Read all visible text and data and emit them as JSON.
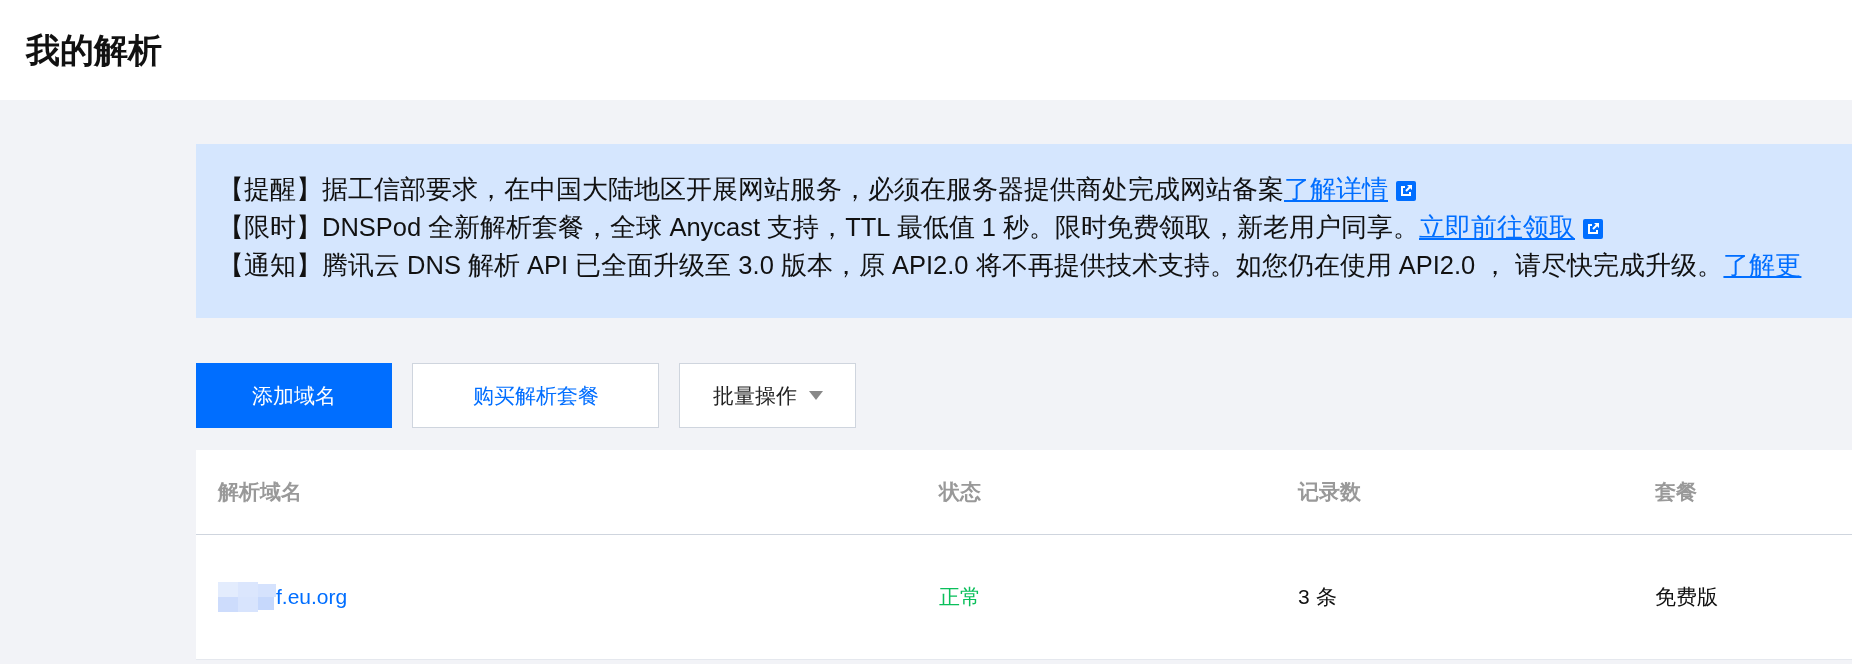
{
  "page_title": "我的解析",
  "notices": [
    {
      "text": "【提醒】据工信部要求，在中国大陆地区开展网站服务，必须在服务器提供商处完成网站备案",
      "link": "了解详情",
      "link_icon": true
    },
    {
      "text": "【限时】DNSPod 全新解析套餐，全球 Anycast 支持，TTL 最低值 1 秒。限时免费领取，新老用户同享。",
      "link": "立即前往领取",
      "link_icon": true
    },
    {
      "text": "【通知】腾讯云 DNS 解析 API 已全面升级至 3.0 版本，原 API2.0 将不再提供技术支持。如您仍在使用 API2.0 ， 请尽快完成升级。",
      "link": "了解更",
      "link_icon": false
    }
  ],
  "buttons": [
    {
      "label": "添加域名",
      "kind": "primary"
    },
    {
      "label": "购买解析套餐",
      "kind": "outline"
    },
    {
      "label": "批量操作",
      "kind": "dropdown"
    }
  ],
  "table": {
    "columns": [
      "解析域名",
      "状态",
      "记录数",
      "套餐"
    ],
    "rows": [
      {
        "domain": "f.eu.org",
        "domain_redacted": true,
        "status": "正常",
        "records": "3 条",
        "plan": "免费版"
      }
    ]
  }
}
